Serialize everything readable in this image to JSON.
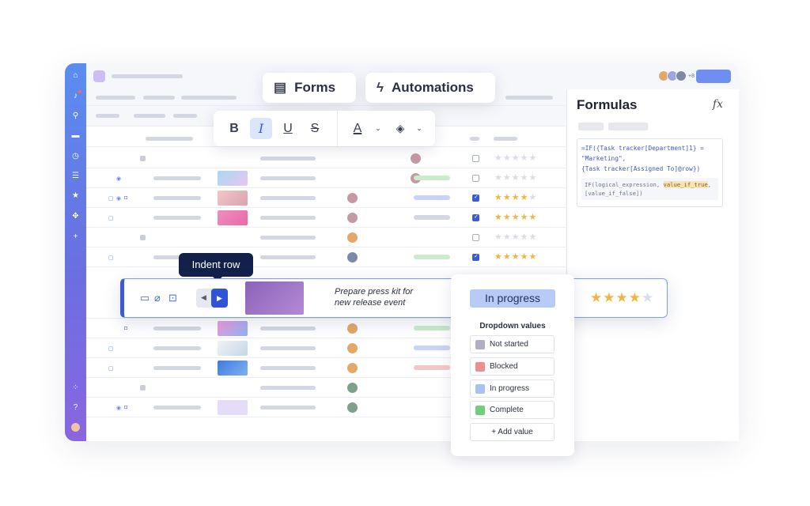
{
  "tabs": {
    "forms_label": "Forms",
    "automations_label": "Automations"
  },
  "formatting": {
    "bold": "B",
    "italic": "I",
    "underline": "U",
    "strike": "S",
    "text_color": "A"
  },
  "formulas": {
    "title": "Formulas",
    "line1": "=IF({Task tracker[Department]1} =",
    "line2": "\"Marketing\",",
    "line3": "{Task tracker[Assigned To]@row})",
    "hint_prefix": "IF(logical_expression, ",
    "hint_highlight": "value_if_true",
    "hint_suffix": ",",
    "hint_line2": "[value_if_false])"
  },
  "tooltip": {
    "label": "Indent row"
  },
  "highlighted_row": {
    "task_line1": "Prepare press kit for",
    "task_line2": "new  release event",
    "rating": 4,
    "rating_max": 5
  },
  "dropdown": {
    "current_value": "In progress",
    "label": "Dropdown values",
    "options": [
      {
        "label": "Not started",
        "color": "#b3aec6"
      },
      {
        "label": "Blocked",
        "color": "#ee8f8f"
      },
      {
        "label": "In progress",
        "color": "#a8c1f6"
      },
      {
        "label": "Complete",
        "color": "#6fcf7a"
      }
    ],
    "add_label": "Add value"
  },
  "grid_rows": [
    {
      "checked": false,
      "rating": 0
    },
    {
      "checked": false,
      "rating": 0
    },
    {
      "checked": true,
      "rating": 4
    },
    {
      "checked": true,
      "rating": 5
    },
    {
      "checked": false,
      "rating": 0
    },
    {
      "checked": true,
      "rating": 5
    }
  ],
  "colors": {
    "accent": "#3b5bd6",
    "star": "#f2b544",
    "tooltip_bg": "#13204a"
  }
}
